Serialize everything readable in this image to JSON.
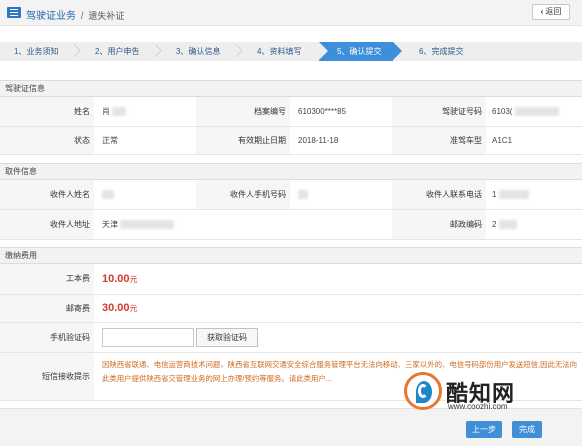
{
  "header": {
    "breadcrumb_main": "驾驶证业务",
    "breadcrumb_sep": "/",
    "breadcrumb_sub": "遗失补证",
    "back_label": "返回"
  },
  "steps": [
    {
      "label": "1、业务须知",
      "active": false
    },
    {
      "label": "2、用户申告",
      "active": false
    },
    {
      "label": "3、确认信息",
      "active": false
    },
    {
      "label": "4、资料填写",
      "active": false
    },
    {
      "label": "5、确认提交",
      "active": true
    },
    {
      "label": "6、完成提交",
      "active": false
    }
  ],
  "license_section": {
    "title": "驾驶证信息",
    "name_label": "姓名",
    "name_value": "肖",
    "file_no_label": "档案编号",
    "file_no_value": "610300****85",
    "license_no_label": "驾驶证号码",
    "license_no_value": "6103(",
    "status_label": "状态",
    "status_value": "正常",
    "expiry_label": "有效期止日期",
    "expiry_value": "2018-11-18",
    "vehicle_label": "准驾车型",
    "vehicle_value": "A1C1"
  },
  "delivery_section": {
    "title": "取件信息",
    "recipient_name_label": "收件人姓名",
    "recipient_phone_label": "收件人手机号码",
    "recipient_contact_label": "收件人联系电话",
    "recipient_contact_value": "1",
    "recipient_address_label": "收件人地址",
    "recipient_address_value": "天津",
    "postcode_label": "邮政编码",
    "postcode_value": "2"
  },
  "fee_section": {
    "title": "缴纳费用",
    "cost_label": "工本费",
    "cost_value": "10.00",
    "cost_unit": "元",
    "postage_label": "邮寄费",
    "postage_value": "30.00",
    "postage_unit": "元",
    "code_label": "手机验证码",
    "code_placeholder": "",
    "code_button": "获取验证码",
    "sms_label": "短信接收提示",
    "sms_text": "因陕西省联通、电信运营商技术问题，陕西省互联网交通安全综合服务管理平台无法向移动、三家以外的、电信号码部份用户发送短信,因此无法向此类用户提供陕西省交管理业务的网上办理/预约等服务。请此类用户..."
  },
  "footer": {
    "prev_label": "上一步",
    "finish_label": "完成"
  },
  "watermark": {
    "title": "酷知网",
    "url": "www.coozhi.com"
  }
}
